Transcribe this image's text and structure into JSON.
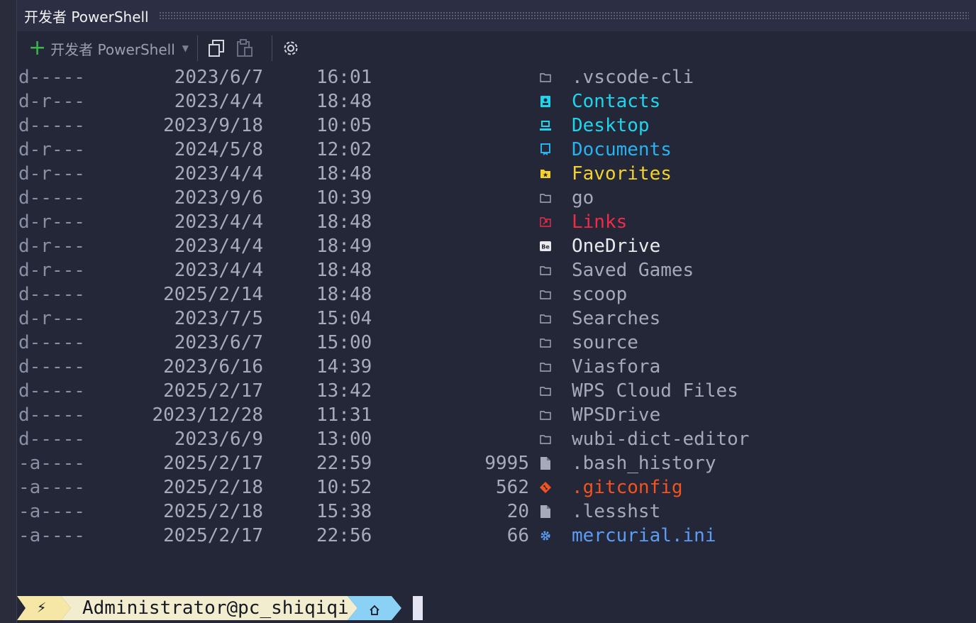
{
  "window": {
    "title": "开发者 PowerShell"
  },
  "toolbar": {
    "profile_label": "开发者 PowerShell",
    "icons": [
      "plus-icon",
      "dropdown-caret-icon",
      "copy-icon",
      "paste-icon",
      "settings-gear-icon"
    ]
  },
  "listing": [
    {
      "mode": "d-----",
      "date": "2023/6/7",
      "time": "16:01",
      "size": "",
      "name": ".vscode-cli",
      "icon": "folder-icon",
      "color": "#a4a9bb"
    },
    {
      "mode": "d-r---",
      "date": "2023/4/4",
      "time": "18:48",
      "size": "",
      "name": "Contacts",
      "icon": "contacts-icon",
      "color": "#1dd6ee"
    },
    {
      "mode": "d-----",
      "date": "2023/9/18",
      "time": "10:05",
      "size": "",
      "name": "Desktop",
      "icon": "desktop-icon",
      "color": "#1dd6ee"
    },
    {
      "mode": "d-r---",
      "date": "2024/5/8",
      "time": "12:02",
      "size": "",
      "name": "Documents",
      "icon": "documents-icon",
      "color": "#27b2f0"
    },
    {
      "mode": "d-r---",
      "date": "2023/4/4",
      "time": "18:48",
      "size": "",
      "name": "Favorites",
      "icon": "favorites-folder-icon",
      "color": "#f4d22e"
    },
    {
      "mode": "d-----",
      "date": "2023/9/6",
      "time": "10:39",
      "size": "",
      "name": "go",
      "icon": "folder-icon",
      "color": "#a4a9bb"
    },
    {
      "mode": "d-r---",
      "date": "2023/4/4",
      "time": "18:48",
      "size": "",
      "name": "Links",
      "icon": "links-folder-icon",
      "color": "#ee2c4a"
    },
    {
      "mode": "d-r---",
      "date": "2023/4/4",
      "time": "18:49",
      "size": "",
      "name": "OneDrive",
      "icon": "onedrive-icon",
      "color": "#e9e9ee"
    },
    {
      "mode": "d-r---",
      "date": "2023/4/4",
      "time": "18:48",
      "size": "",
      "name": "Saved Games",
      "icon": "folder-icon",
      "color": "#a4a9bb"
    },
    {
      "mode": "d-----",
      "date": "2025/2/14",
      "time": "18:48",
      "size": "",
      "name": "scoop",
      "icon": "folder-icon",
      "color": "#a4a9bb"
    },
    {
      "mode": "d-r---",
      "date": "2023/7/5",
      "time": "15:04",
      "size": "",
      "name": "Searches",
      "icon": "folder-icon",
      "color": "#a4a9bb"
    },
    {
      "mode": "d-----",
      "date": "2023/6/7",
      "time": "15:00",
      "size": "",
      "name": "source",
      "icon": "folder-icon",
      "color": "#a4a9bb"
    },
    {
      "mode": "d-----",
      "date": "2023/6/16",
      "time": "14:39",
      "size": "",
      "name": "Viasfora",
      "icon": "folder-icon",
      "color": "#a4a9bb"
    },
    {
      "mode": "d-----",
      "date": "2025/2/17",
      "time": "13:42",
      "size": "",
      "name": "WPS Cloud Files",
      "icon": "folder-icon",
      "color": "#a4a9bb"
    },
    {
      "mode": "d-----",
      "date": "2023/12/28",
      "time": "11:31",
      "size": "",
      "name": "WPSDrive",
      "icon": "folder-icon",
      "color": "#a4a9bb"
    },
    {
      "mode": "d-----",
      "date": "2023/6/9",
      "time": "13:00",
      "size": "",
      "name": "wubi-dict-editor",
      "icon": "folder-icon",
      "color": "#a4a9bb"
    },
    {
      "mode": "-a----",
      "date": "2025/2/17",
      "time": "22:59",
      "size": "9995",
      "name": ".bash_history",
      "icon": "file-icon",
      "color": "#a4a9bb"
    },
    {
      "mode": "-a----",
      "date": "2025/2/18",
      "time": "10:52",
      "size": "562",
      "name": ".gitconfig",
      "icon": "git-icon",
      "color": "#f4521e"
    },
    {
      "mode": "-a----",
      "date": "2025/2/18",
      "time": "15:38",
      "size": "20",
      "name": ".lesshst",
      "icon": "file-icon",
      "color": "#a4a9bb"
    },
    {
      "mode": "-a----",
      "date": "2025/2/17",
      "time": "22:56",
      "size": "66",
      "name": "mercurial.ini",
      "icon": "config-gear-icon",
      "color": "#5b9cf5"
    }
  ],
  "prompt": {
    "segment1_icon": "lightning-icon",
    "segment1_color": "#f7e7a6",
    "user_host": "Administrator@pc_shiqiqi",
    "segment2_color": "#f3edcf",
    "segment3_icon": "home-icon",
    "segment3_color": "#8bd0f5"
  }
}
